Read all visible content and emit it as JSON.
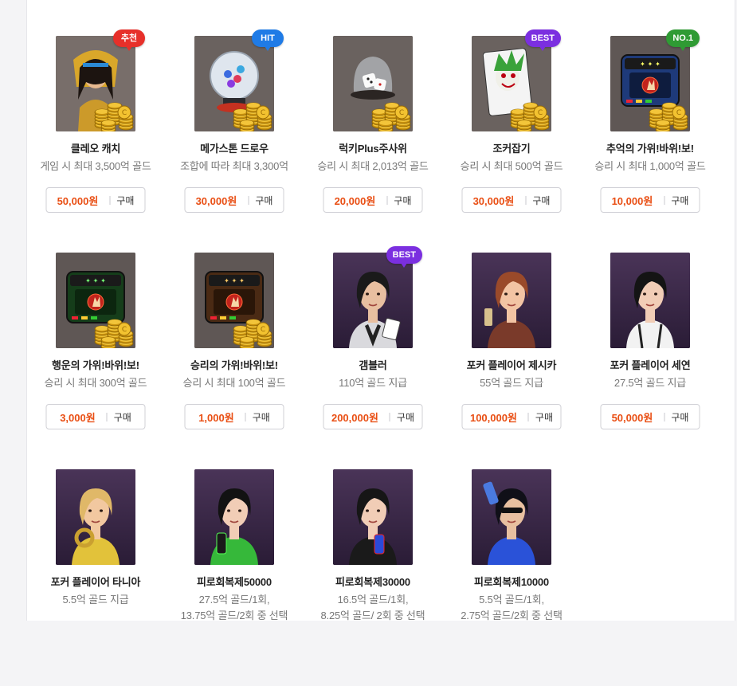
{
  "colors": {
    "price": "#e94e13",
    "badge_red": "#e7302a",
    "badge_blue": "#1f7be6",
    "badge_purple": "#7b2fe0",
    "badge_green": "#2f9b34"
  },
  "products": [
    {
      "name": "클레오 캐치",
      "desc": [
        "게임 시 최대 3,500억 골드"
      ],
      "price": "50,000원",
      "buy": "구매",
      "badge": "추천",
      "badge_color": "#e7302a",
      "art": "cleo"
    },
    {
      "name": "메가스톤 드로우",
      "desc": [
        "조합에 따라 최대 3,300억"
      ],
      "price": "30,000원",
      "buy": "구매",
      "badge": "HIT",
      "badge_color": "#1f7be6",
      "art": "orb"
    },
    {
      "name": "럭키Plus주사위",
      "desc": [
        "승리 시 최대 2,013억 골드"
      ],
      "price": "20,000원",
      "buy": "구매",
      "badge": "",
      "badge_color": "",
      "art": "dice"
    },
    {
      "name": "조커잡기",
      "desc": [
        "승리 시 최대 500억 골드"
      ],
      "price": "30,000원",
      "buy": "구매",
      "badge": "BEST",
      "badge_color": "#7b2fe0",
      "art": "joker"
    },
    {
      "name": "추억의 가위!바위!보!",
      "desc": [
        "승리 시 최대 1,000억 골드"
      ],
      "price": "10,000원",
      "buy": "구매",
      "badge": "NO.1",
      "badge_color": "#2f9b34",
      "art": "rps_blue"
    },
    {
      "name": "행운의 가위!바위!보!",
      "desc": [
        "승리 시 최대 300억 골드"
      ],
      "price": "3,000원",
      "buy": "구매",
      "badge": "",
      "badge_color": "",
      "art": "rps_green"
    },
    {
      "name": "승리의 가위!바위!보!",
      "desc": [
        "승리 시 최대 100억 골드"
      ],
      "price": "1,000원",
      "buy": "구매",
      "badge": "",
      "badge_color": "",
      "art": "rps_brown"
    },
    {
      "name": "갬블러",
      "desc": [
        "110억 골드 지급"
      ],
      "price": "200,000원",
      "buy": "구매",
      "badge": "BEST",
      "badge_color": "#7b2fe0",
      "art": "gambler"
    },
    {
      "name": "포커 플레이어 제시카",
      "desc": [
        "55억 골드 지급"
      ],
      "price": "100,000원",
      "buy": "구매",
      "badge": "",
      "badge_color": "",
      "art": "jessica"
    },
    {
      "name": "포커 플레이어 세연",
      "desc": [
        "27.5억 골드 지급"
      ],
      "price": "50,000원",
      "buy": "구매",
      "badge": "",
      "badge_color": "",
      "art": "seyeon"
    },
    {
      "name": "포커 플레이어 타니아",
      "desc": [
        "5.5억 골드 지급"
      ],
      "price": "",
      "buy": "",
      "badge": "",
      "badge_color": "",
      "art": "tania"
    },
    {
      "name": "피로회복제50000",
      "desc": [
        "27.5억 골드/1회,",
        "13.75억 골드/2회 중 선택"
      ],
      "price": "",
      "buy": "",
      "badge": "",
      "badge_color": "",
      "art": "p50000"
    },
    {
      "name": "피로회복제30000",
      "desc": [
        "16.5억 골드/1회,",
        "8.25억 골드/ 2회 중 선택"
      ],
      "price": "",
      "buy": "",
      "badge": "",
      "badge_color": "",
      "art": "p30000"
    },
    {
      "name": "피로회복제10000",
      "desc": [
        "5.5억 골드/1회,",
        "2.75억 골드/2회 중 선택"
      ],
      "price": "",
      "buy": "",
      "badge": "",
      "badge_color": "",
      "art": "p10000"
    }
  ]
}
